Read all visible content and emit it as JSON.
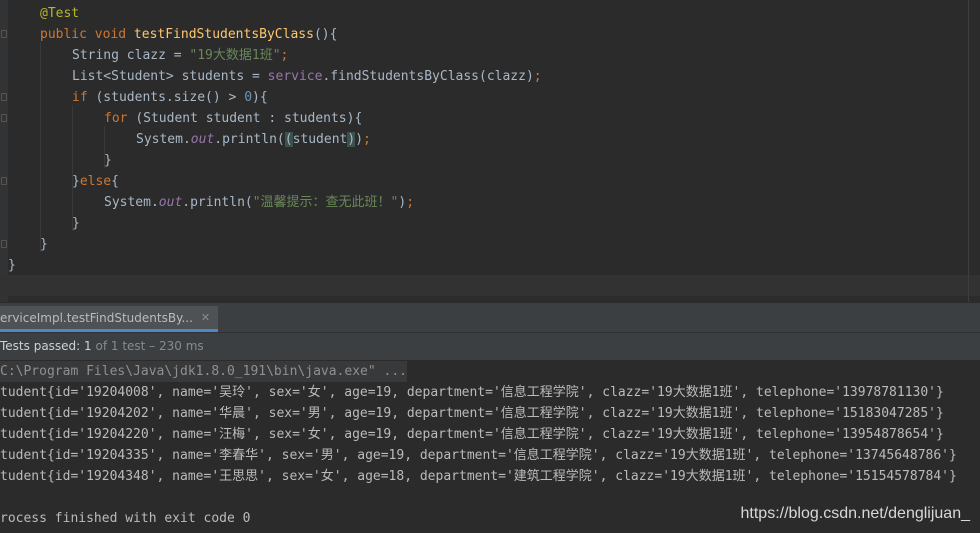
{
  "editor": {
    "lines": [
      [
        [
          "ann",
          "@Test"
        ]
      ],
      [
        [
          "kw",
          "public void "
        ],
        [
          "fn",
          "testFindStudentsByClass"
        ],
        [
          "plain",
          "(){"
        ]
      ],
      [
        [
          "plain",
          "String clazz = "
        ],
        [
          "str",
          "\"19大数据1班\""
        ],
        [
          "kw",
          ";"
        ]
      ],
      [
        [
          "plain",
          "List<Student> students = "
        ],
        [
          "svc",
          "service"
        ],
        [
          "plain",
          ".findStudentsByClass(clazz)"
        ],
        [
          "kw",
          ";"
        ]
      ],
      [
        [
          "kw",
          "if "
        ],
        [
          "plain",
          "(students.size() > "
        ],
        [
          "num",
          "0"
        ],
        [
          "plain",
          "){"
        ]
      ],
      [
        [
          "kw",
          "for "
        ],
        [
          "plain",
          "(Student student : students){"
        ]
      ],
      [
        [
          "plain",
          "System."
        ],
        [
          "fld",
          "out"
        ],
        [
          "plain",
          ".println("
        ],
        [
          "hi",
          "("
        ],
        [
          "plain",
          "student"
        ],
        [
          "hi",
          ")"
        ],
        [
          "plain",
          ")"
        ],
        [
          "kw",
          ";"
        ]
      ],
      [
        [
          "plain",
          "}"
        ]
      ],
      [
        [
          "plain",
          "}"
        ],
        [
          "kw",
          "else"
        ],
        [
          "plain",
          "{"
        ]
      ],
      [
        [
          "plain",
          "System."
        ],
        [
          "fld",
          "out"
        ],
        [
          "plain",
          ".println("
        ],
        [
          "str",
          "\"温馨提示：查无此班！\""
        ],
        [
          "plain",
          ")"
        ],
        [
          "kw",
          ";"
        ]
      ],
      [
        [
          "plain",
          "}"
        ]
      ],
      [
        [
          "plain",
          "}"
        ]
      ],
      [
        [
          "plain",
          "}"
        ]
      ]
    ]
  },
  "run_panel": {
    "tab_label": "erviceImpl.testFindStudentsBy...",
    "close_glyph": "✕",
    "tests_passed": "Tests passed: 1",
    "test_count": " of 1 test – 230 ms"
  },
  "console": {
    "command": "C:\\Program Files\\Java\\jdk1.8.0_191\\bin\\java.exe\" ...",
    "rows": [
      "tudent{id='19204008', name='吴玲', sex='女', age=19, department='信息工程学院', clazz='19大数据1班', telephone='13978781130'}",
      "tudent{id='19204202', name='华晨', sex='男', age=19, department='信息工程学院', clazz='19大数据1班', telephone='15183047285'}",
      "tudent{id='19204220', name='汪梅', sex='女', age=19, department='信息工程学院', clazz='19大数据1班', telephone='13954878654'}",
      "tudent{id='19204335', name='李春华', sex='男', age=19, department='信息工程学院', clazz='19大数据1班', telephone='13745648786'}",
      "tudent{id='19204348', name='王思思', sex='女', age=18, department='建筑工程学院', clazz='19大数据1班', telephone='15154578784'}"
    ],
    "exit": "rocess finished with exit code 0"
  },
  "watermark": "https://blog.csdn.net/denglijuan_"
}
